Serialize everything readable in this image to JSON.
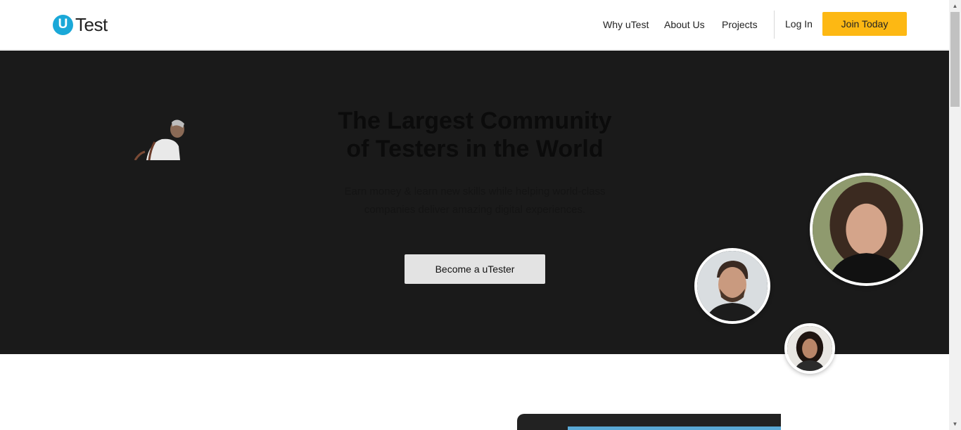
{
  "header": {
    "logo_mark": "U",
    "logo_text": "Test",
    "nav": [
      "Why uTest",
      "About Us",
      "Projects"
    ],
    "login_label": "Log In",
    "join_label": "Join Today"
  },
  "hero": {
    "title_line1": "The Largest Community",
    "title_line2": "of Testers in the World",
    "subtitle_line1": "Earn money & learn new skills while helping world-class",
    "subtitle_line2": "companies deliver amazing digital experiences.",
    "cta_label": "Become a uTester"
  },
  "colors": {
    "brand_blue": "#1aa8d8",
    "join_yellow": "#fdb813",
    "hero_bg": "#1a1a1a"
  },
  "scrollbar": {
    "up_arrow": "▲",
    "down_arrow": "▼"
  }
}
